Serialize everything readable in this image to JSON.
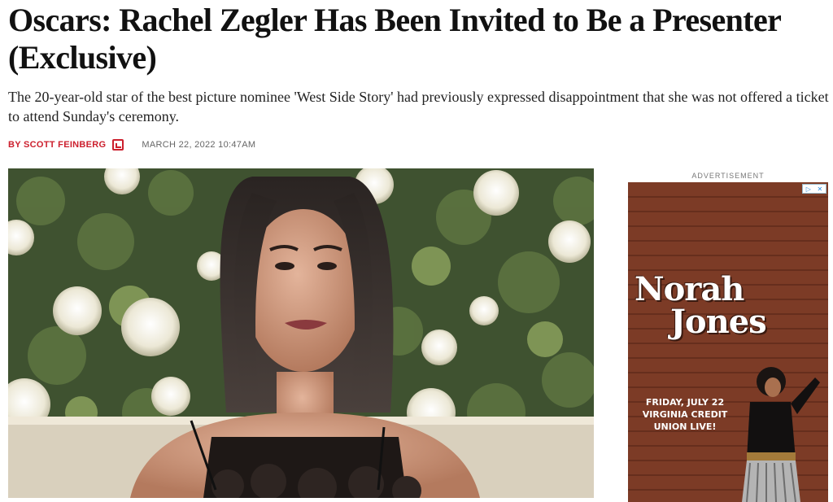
{
  "article": {
    "headline": "Oscars: Rachel Zegler Has Been Invited to Be a Presenter (Exclusive)",
    "dek": "The 20-year-old star of the best picture nominee 'West Side Story' had previously expressed disappointment that she was not offered a ticket to attend Sunday's ceremony.",
    "author": "BY SCOTT FEINBERG",
    "author_icon": "author-profile-icon",
    "date": "MARCH 22, 2022 10:47AM"
  },
  "hero_image": {
    "subject": "portrait-photo"
  },
  "ad": {
    "label": "ADVERTISEMENT",
    "choices_icon": "ad-choices-icon",
    "close_icon": "close-icon",
    "title_line1": "Norah",
    "title_line2": "Jones",
    "event_line1": "FRIDAY, JULY 22",
    "event_line2": "VIRGINIA CREDIT",
    "event_line3": "UNION LIVE!"
  },
  "colors": {
    "accent": "#cc1f2d",
    "brick": "#7c3b26"
  }
}
